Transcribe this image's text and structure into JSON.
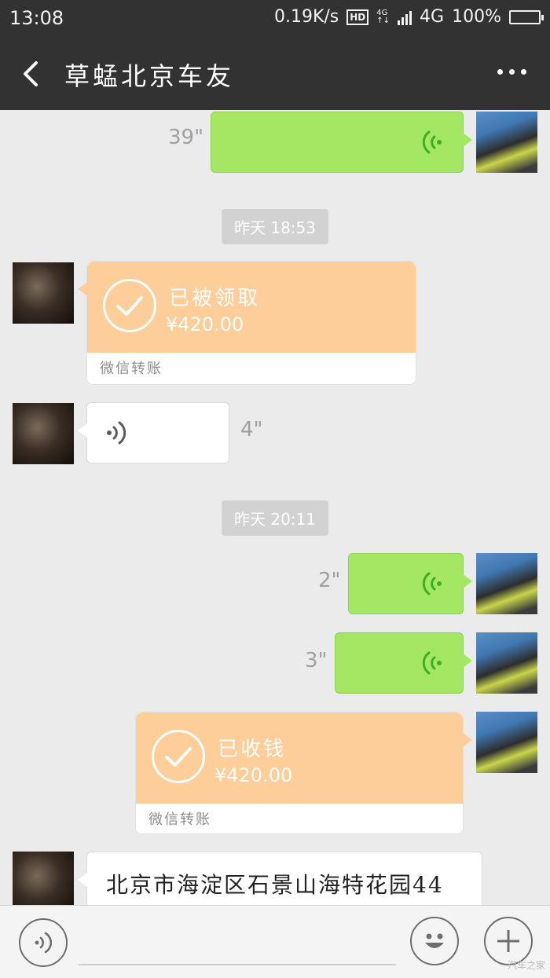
{
  "status_bar": {
    "time": "13:08",
    "net_speed": "0.19K/s",
    "hd_badge": "HD",
    "net_mini_top": "4G",
    "net_mini_bottom": "↑↓",
    "network": "4G",
    "battery": "100%",
    "battery_level": 1.0
  },
  "header": {
    "title": "草蜢北京车友",
    "back_icon": "chevron-left-icon",
    "more_icon": "more-dots-icon"
  },
  "messages": {
    "voice_1": {
      "sender": "me",
      "duration": "39\""
    },
    "timestamp_1": "昨天 18:53",
    "transfer_1": {
      "sender": "other",
      "status": "已被领取",
      "amount": "¥420.00",
      "label": "微信转账"
    },
    "voice_2": {
      "sender": "other",
      "duration": "4\""
    },
    "timestamp_2": "昨天 20:11",
    "voice_3": {
      "sender": "me",
      "duration": "2\""
    },
    "voice_4": {
      "sender": "me",
      "duration": "3\""
    },
    "transfer_2": {
      "sender": "me",
      "status": "已收钱",
      "amount": "¥420.00",
      "label": "微信转账"
    },
    "text_1": {
      "sender": "other",
      "text": "北京市海淀区石景山海特花园44"
    }
  },
  "input_bar": {
    "voice_button_icon": "voice-mode-icon",
    "emoji_button_icon": "emoji-icon",
    "plus_button_icon": "plus-icon",
    "watermark": "汽车之家"
  },
  "colors": {
    "bar_bg": "#323232",
    "chat_bg": "#ebebeb",
    "my_bubble": "#a3e762",
    "transfer_bg": "#fdce9a",
    "voice_green": "#3dae23",
    "voice_gray": "#5a5a5a"
  }
}
